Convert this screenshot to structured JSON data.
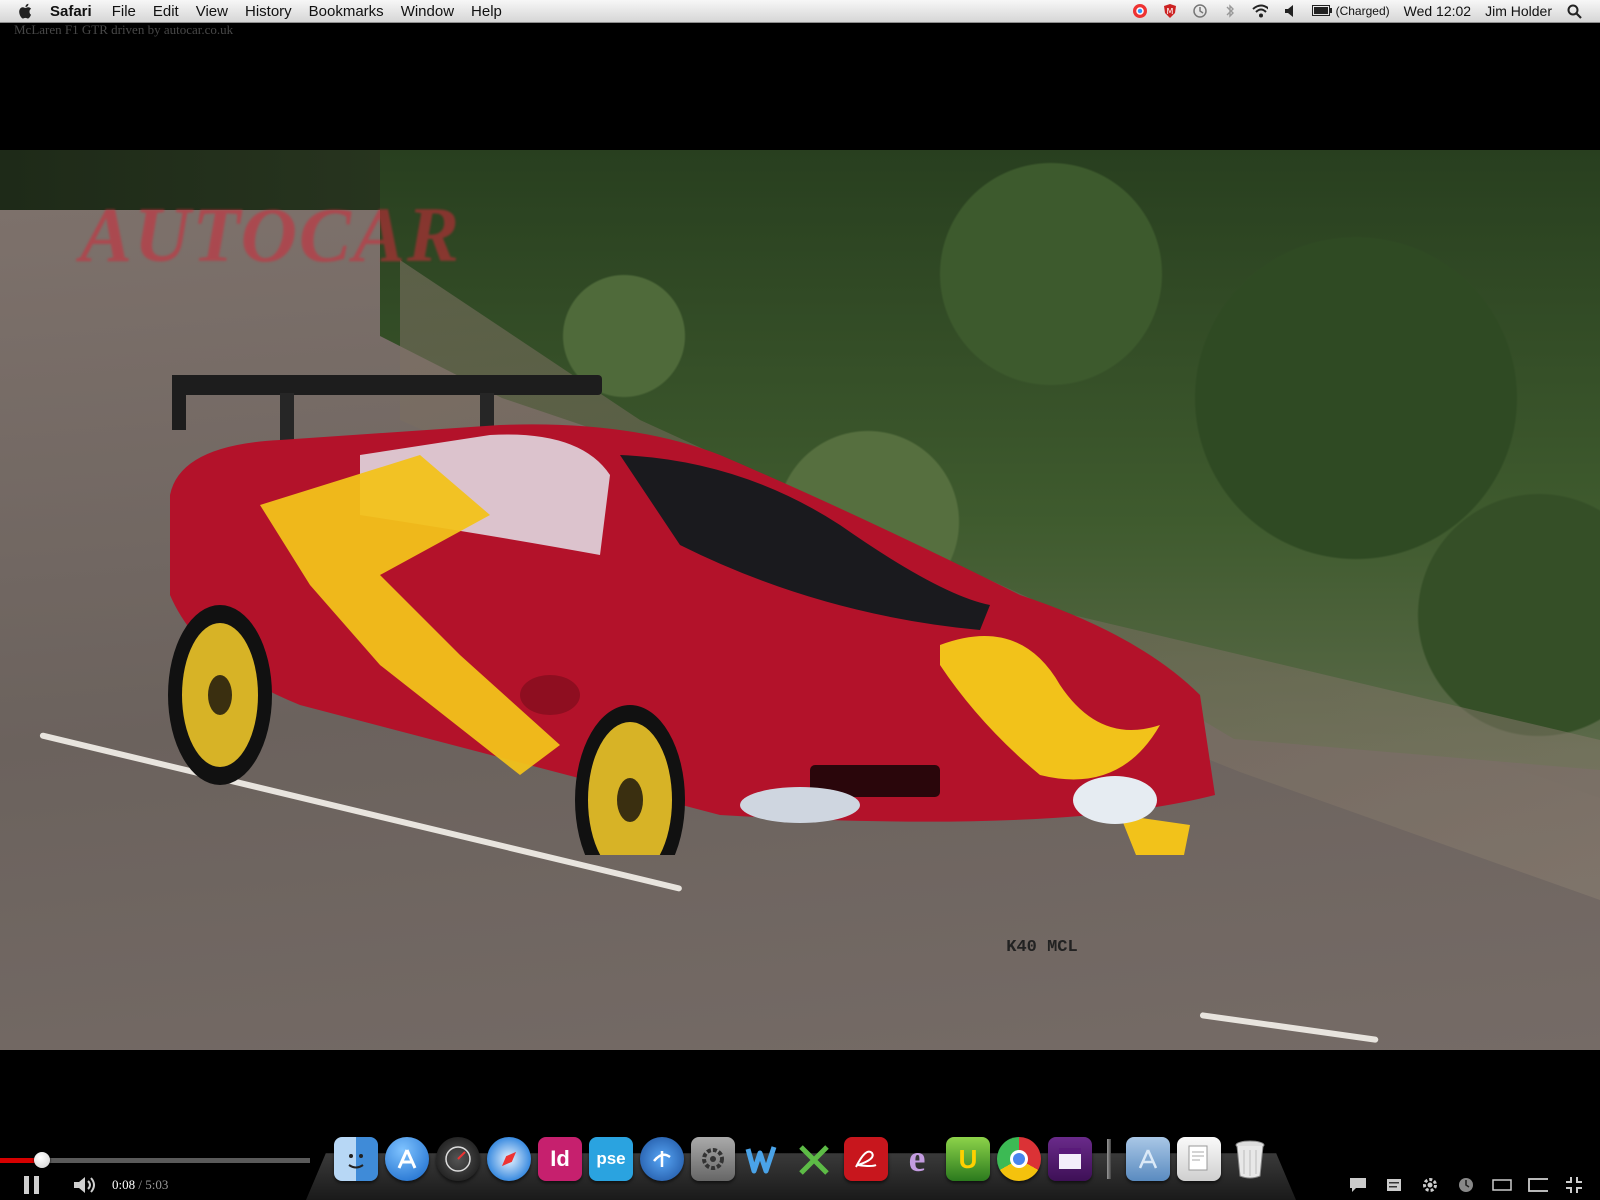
{
  "menubar": {
    "app_name": "Safari",
    "menus": [
      "File",
      "Edit",
      "View",
      "History",
      "Bookmarks",
      "Window",
      "Help"
    ],
    "battery_status": "(Charged)",
    "clock": "Wed 12:02",
    "user": "Jim Holder"
  },
  "video": {
    "title": "McLaren F1 GTR driven by autocar.co.uk",
    "watermark": "AUTOCAR",
    "license_plate": "K40 MCL"
  },
  "player": {
    "current_time": "0:08",
    "separator": " / ",
    "total_time": "5:03",
    "progress_fraction": 0.0264
  },
  "dock": {
    "items": [
      "finder-icon",
      "app-store-icon",
      "dashboard-icon",
      "safari-icon",
      "indesign-icon",
      "photoshop-elements-icon",
      "google-earth-icon",
      "system-preferences-icon",
      "word-icon",
      "excel-icon",
      "acrobat-icon",
      "entourage-icon",
      "ultra-icon",
      "chrome-icon",
      "calendar-icon",
      "applications-folder-icon",
      "documents-icon",
      "trash-icon"
    ]
  },
  "colors": {
    "progress": "#d60000",
    "watermark": "#d12a3a",
    "car_body": "#b3122a",
    "car_stripe": "#f2c21a"
  }
}
